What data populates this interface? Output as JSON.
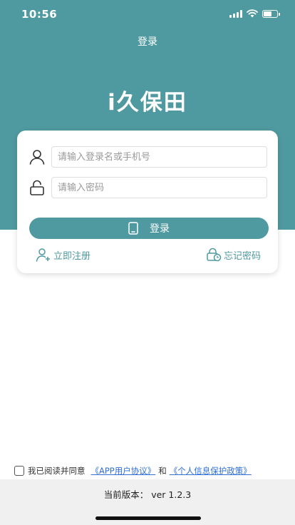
{
  "status_bar": {
    "time": "10:56",
    "icons": [
      "signal-icon",
      "wifi-icon",
      "battery-icon"
    ]
  },
  "header": {
    "nav_title": "登录",
    "app_name": "i久保田"
  },
  "login_form": {
    "username": {
      "placeholder": "请输入登录名或手机号",
      "value": "",
      "icon": "user-icon"
    },
    "password": {
      "placeholder": "请输入密码",
      "value": "",
      "icon": "lock-icon"
    },
    "login_button": {
      "label": "登录",
      "icon": "phone-icon"
    },
    "register_link": {
      "label": "立即注册",
      "icon": "add-user-icon"
    },
    "forgot_link": {
      "label": "忘记密码",
      "icon": "lock-clock-icon"
    }
  },
  "agreement": {
    "checked": false,
    "prefix": "我已阅读并同意",
    "app_agreement": "《APP用户协议》",
    "conjunction": "和",
    "privacy_policy": "《个人信息保护政策》"
  },
  "footer": {
    "version_text": "当前版本：  ver 1.2.3"
  },
  "colors": {
    "primary": "#4f9aa0",
    "link": "#2f6fd6",
    "footer_bg": "#f0f0f0"
  }
}
